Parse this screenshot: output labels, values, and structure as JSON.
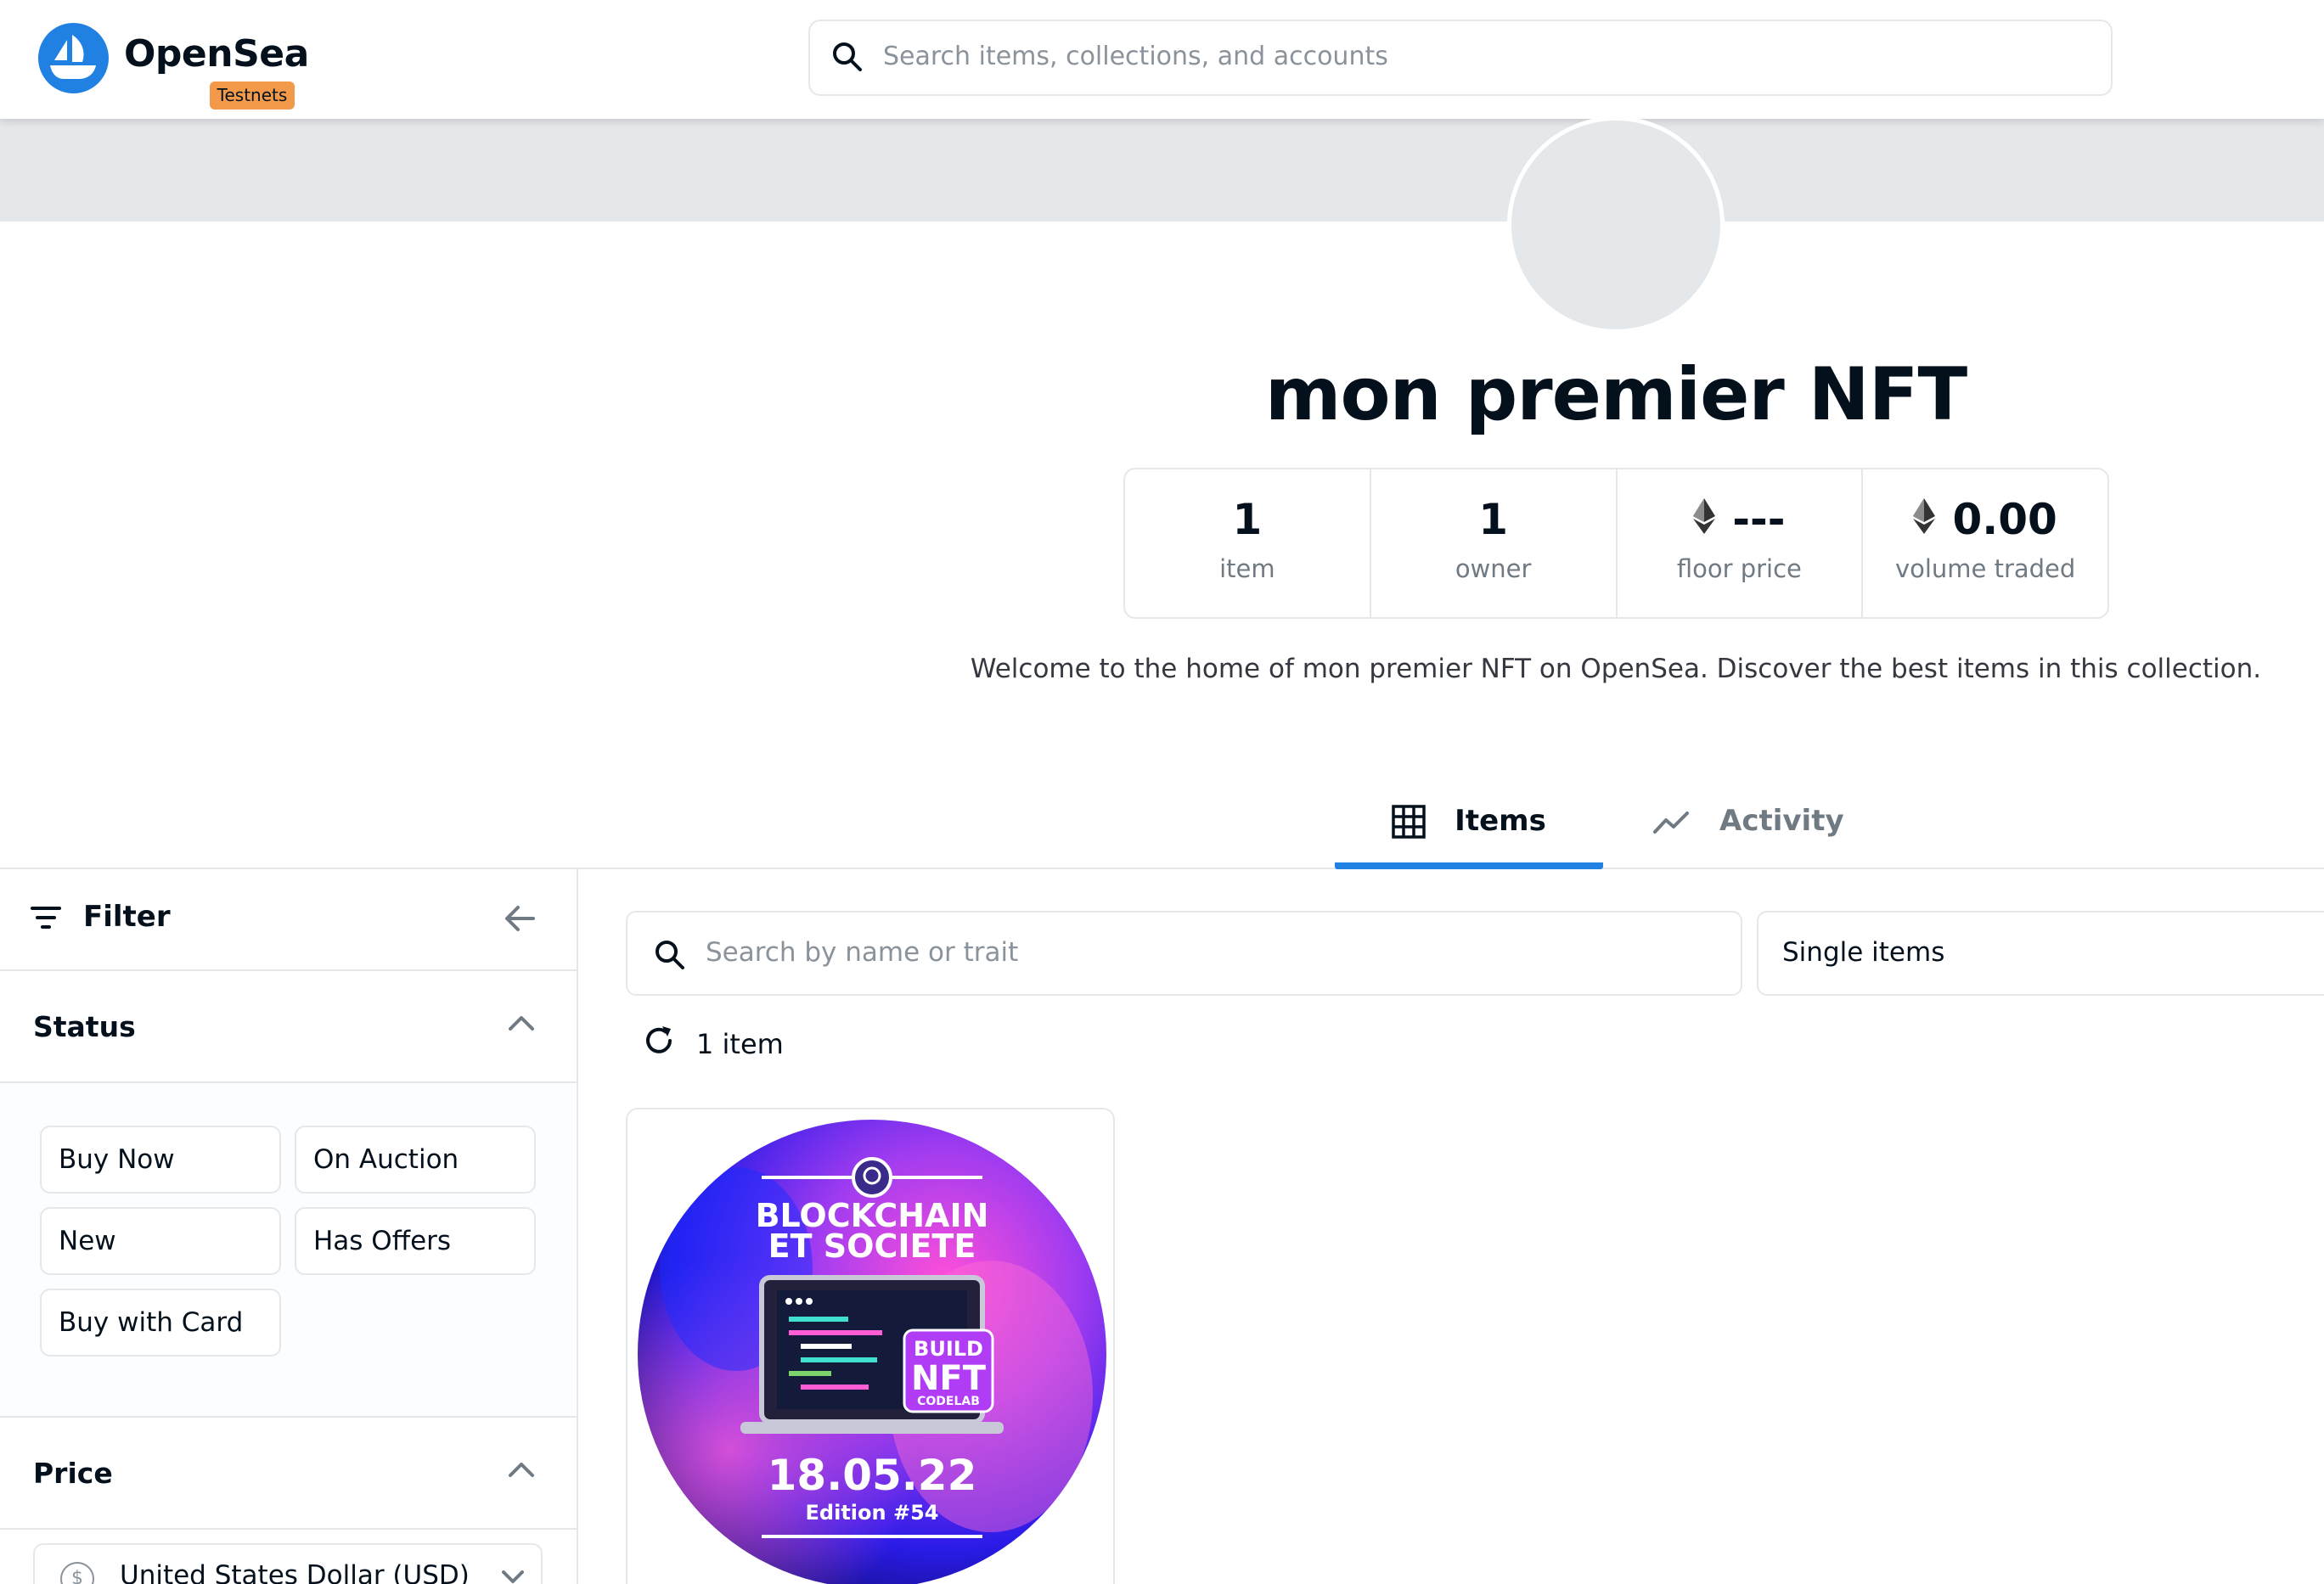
{
  "header": {
    "brand": "OpenSea",
    "badge": "Testnets",
    "search_placeholder": "Search items, collections, and accounts"
  },
  "collection": {
    "title": "mon premier NFT",
    "description": "Welcome to the home of mon premier NFT on OpenSea. Discover the best items in this collection.",
    "stats": [
      {
        "value": "1",
        "label": "item",
        "eth": false
      },
      {
        "value": "1",
        "label": "owner",
        "eth": false
      },
      {
        "value": "---",
        "label": "floor price",
        "eth": true
      },
      {
        "value": "0.00",
        "label": "volume traded",
        "eth": true
      }
    ]
  },
  "tabs": [
    {
      "label": "Items",
      "active": true,
      "icon": "grid-icon"
    },
    {
      "label": "Activity",
      "active": false,
      "icon": "activity-chart-icon"
    }
  ],
  "sidebar": {
    "filter_label": "Filter",
    "status_label": "Status",
    "status_options": [
      "Buy Now",
      "On Auction",
      "New",
      "Has Offers",
      "Buy with Card"
    ],
    "price_label": "Price",
    "currency": "United States Dollar (USD)"
  },
  "main": {
    "search_placeholder": "Search by name or trait",
    "view_select": "Single items",
    "item_count": "1 item"
  },
  "nft": {
    "line1": "BLOCKCHAIN",
    "line2": "ET SOCIETE",
    "badge1": "BUILD",
    "badge2": "NFT",
    "badge3": "CODELAB",
    "date": "18.05.22",
    "edition": "Edition #54"
  },
  "colors": {
    "accent": "#2081e2",
    "badge": "#f2994a",
    "border": "#e5e8eb",
    "muted_text": "#707a83"
  }
}
